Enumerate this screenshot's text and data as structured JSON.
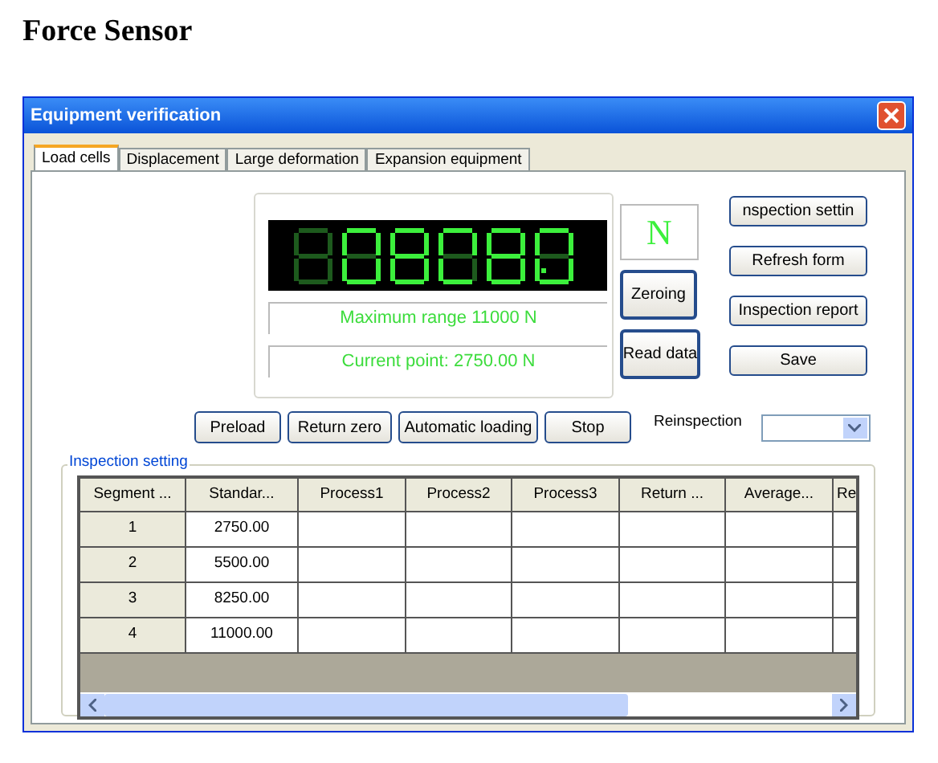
{
  "page_title": "Force Sensor",
  "window": {
    "title": "Equipment verification"
  },
  "tabs": [
    {
      "label": "Load cells",
      "selected": true
    },
    {
      "label": "Displacement",
      "selected": false
    },
    {
      "label": "Large deformation",
      "selected": false
    },
    {
      "label": "Expansion equipment",
      "selected": false
    }
  ],
  "readout": {
    "unit": "N",
    "max_range": "Maximum range  11000 N",
    "current_point": "Current point: 2750.00 N"
  },
  "display_buttons": [
    "Zeroing",
    "Read data"
  ],
  "side_buttons": [
    "nspection settin",
    "Refresh form",
    "Inspection report",
    "Save"
  ],
  "action_buttons": [
    "Preload",
    "Return zero",
    "Automatic loading",
    "Stop"
  ],
  "reinspection": {
    "label": "Reinspection"
  },
  "group": {
    "title": "Inspection setting"
  },
  "table": {
    "columns": [
      "Segment ...",
      "Standar...",
      "Process1",
      "Process2",
      "Process3",
      "Return ...",
      "Average...",
      "Re"
    ],
    "rows": [
      [
        "1",
        "2750.00"
      ],
      [
        "2",
        "5500.00"
      ],
      [
        "3",
        "8250.00"
      ],
      [
        "4",
        "11000.00"
      ]
    ]
  }
}
